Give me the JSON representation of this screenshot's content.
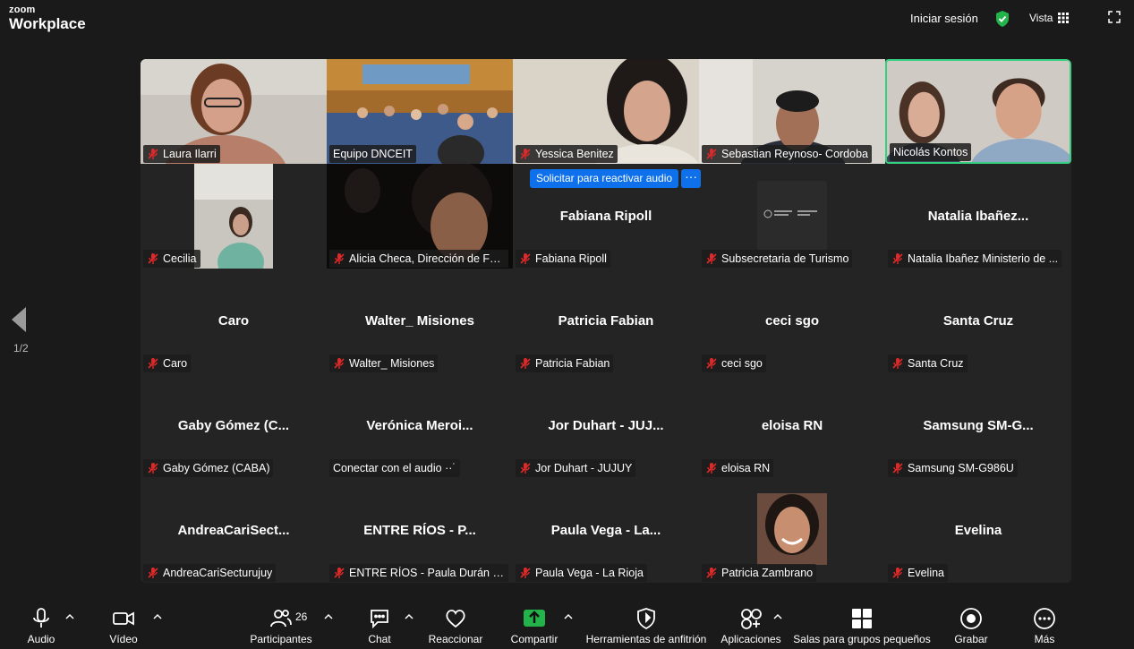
{
  "app": {
    "logo_top": "zoom",
    "logo_bottom": "Workplace",
    "sign_in": "Iniciar sesión",
    "view": "Vista"
  },
  "colors": {
    "accent_blue": "#0e71eb",
    "active_speaker": "#35d07f",
    "share_green": "#22b34a",
    "mute_red": "#e02828"
  },
  "pager": "1/2",
  "reactivate": {
    "label": "Solicitar para reactivar audio",
    "more": "···"
  },
  "tiles": [
    {
      "label": "Laura Ilarri",
      "muted": true
    },
    {
      "label": "Equipo DNCEIT",
      "muted": false
    },
    {
      "label": "Yessica Benitez",
      "muted": true
    },
    {
      "label": "Sebastian Reynoso- Cordoba",
      "muted": true
    },
    {
      "label": "Nicolás Kontos",
      "muted": false
    },
    {
      "label": "Cecilia",
      "muted": true
    },
    {
      "label": "Alicia Checa, Dirección de For...",
      "muted": true
    },
    {
      "center": "Fabiana Ripoll",
      "label": "Fabiana Ripoll",
      "muted": true
    },
    {
      "label": "Subsecretaria de Turismo",
      "muted": true
    },
    {
      "center": "Natalia  Ibañez...",
      "label": "Natalia Ibañez Ministerio de ...",
      "muted": true
    },
    {
      "center": "Caro",
      "label": "Caro",
      "muted": true
    },
    {
      "center": "Walter_ Misiones",
      "label": "Walter_ Misiones",
      "muted": true
    },
    {
      "center": "Patricia Fabian",
      "label": "Patricia Fabian",
      "muted": true
    },
    {
      "center": "ceci sgo",
      "label": "ceci sgo",
      "muted": true
    },
    {
      "center": "Santa Cruz",
      "label": "Santa Cruz",
      "muted": true
    },
    {
      "center": "Gaby Gómez (C...",
      "label": "Gaby Gómez (CABA)",
      "muted": true
    },
    {
      "center": "Verónica  Meroi...",
      "label": "Conectar con el audio ··˙",
      "muted": false
    },
    {
      "center": "Jor Duhart - JUJ...",
      "label": "Jor Duhart - JUJUY",
      "muted": true
    },
    {
      "center": "eloisa RN",
      "label": "eloisa RN",
      "muted": true
    },
    {
      "center": "Samsung  SM-G...",
      "label": "Samsung SM-G986U",
      "muted": true
    },
    {
      "center": "AndreaCariSect...",
      "label": "AndreaCariSecturujuy",
      "muted": true
    },
    {
      "center": "ENTRE RÍOS - P...",
      "label": "ENTRE RÍOS - Paula Durán - ...",
      "muted": true
    },
    {
      "center": "Paula Vega - La...",
      "label": "Paula Vega - La Rioja",
      "muted": true
    },
    {
      "label": "Patricia Zambrano",
      "muted": true
    },
    {
      "center": "Evelina",
      "label": "Evelina",
      "muted": true
    }
  ],
  "toolbar": {
    "audio": "Audio",
    "video": "Vídeo",
    "participants": "Participantes",
    "participants_count": "26",
    "chat": "Chat",
    "react": "Reaccionar",
    "share": "Compartir",
    "host_tools": "Herramientas de anfitrión",
    "apps": "Aplicaciones",
    "breakout": "Salas para grupos pequeños",
    "record": "Grabar",
    "more": "Más"
  }
}
